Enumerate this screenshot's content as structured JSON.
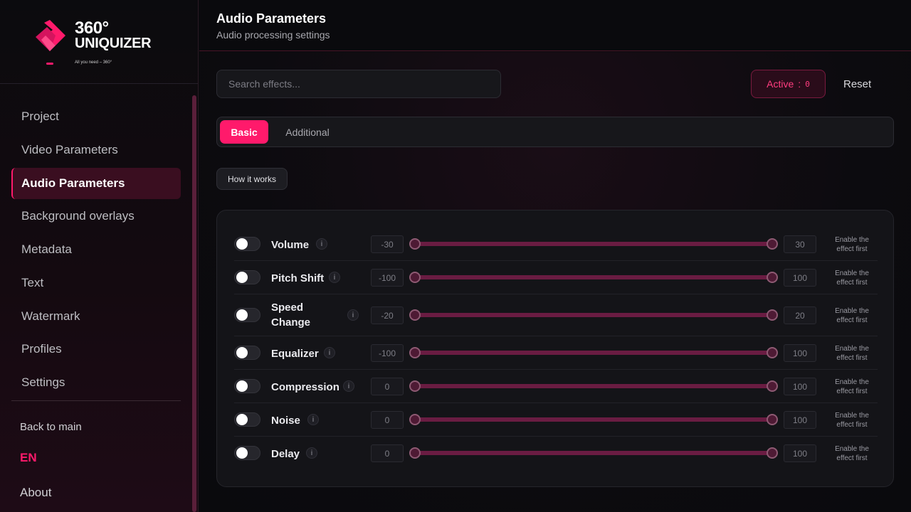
{
  "brand": {
    "line1": "360°",
    "line2": "UNIQUIZER",
    "tagline": "All you need – 360°",
    "accent": "#ff1a6b"
  },
  "sidebar": {
    "items": [
      {
        "label": "Project",
        "active": false
      },
      {
        "label": "Video Parameters",
        "active": false
      },
      {
        "label": "Audio Parameters",
        "active": true
      },
      {
        "label": "Background overlays",
        "active": false
      },
      {
        "label": "Metadata",
        "active": false
      },
      {
        "label": "Text",
        "active": false
      },
      {
        "label": "Watermark",
        "active": false
      },
      {
        "label": "Profiles",
        "active": false
      },
      {
        "label": "Settings",
        "active": false
      }
    ],
    "back": "Back to main",
    "language": "EN",
    "about": "About"
  },
  "header": {
    "title": "Audio Parameters",
    "subtitle": "Audio processing settings"
  },
  "toolbar": {
    "search_placeholder": "Search effects...",
    "active_label": "Active",
    "active_sep": ":",
    "active_count": "0",
    "reset_label": "Reset"
  },
  "tabs": [
    {
      "label": "Basic",
      "selected": true
    },
    {
      "label": "Additional",
      "selected": false
    }
  ],
  "how_it_works": "How it works",
  "effects": [
    {
      "name": "Volume",
      "min": "-30",
      "max": "30",
      "enabled": false,
      "hint": "Enable the effect first",
      "info": "i"
    },
    {
      "name": "Pitch Shift",
      "min": "-100",
      "max": "100",
      "enabled": false,
      "hint": "Enable the effect first",
      "info": "i"
    },
    {
      "name": "Speed Change",
      "min": "-20",
      "max": "20",
      "enabled": false,
      "hint": "Enable the effect first",
      "info": "i"
    },
    {
      "name": "Equalizer",
      "min": "-100",
      "max": "100",
      "enabled": false,
      "hint": "Enable the effect first",
      "info": "i"
    },
    {
      "name": "Compression",
      "min": "0",
      "max": "100",
      "enabled": false,
      "hint": "Enable the effect first",
      "info": "i"
    },
    {
      "name": "Noise",
      "min": "0",
      "max": "100",
      "enabled": false,
      "hint": "Enable the effect first",
      "info": "i"
    },
    {
      "name": "Delay",
      "min": "0",
      "max": "100",
      "enabled": false,
      "hint": "Enable the effect first",
      "info": "i"
    }
  ]
}
